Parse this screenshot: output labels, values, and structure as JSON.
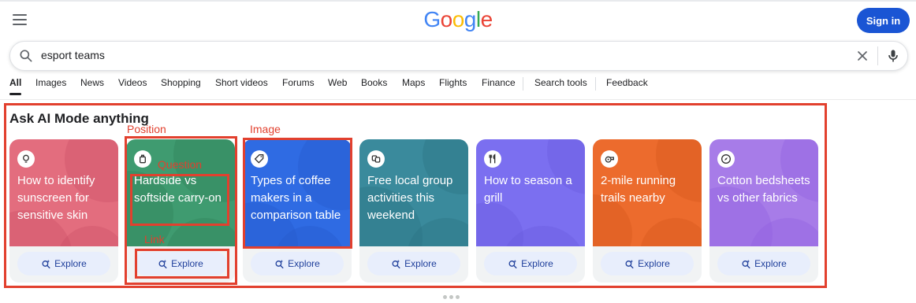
{
  "header": {
    "logo_letters": [
      {
        "ch": "G",
        "color": "#4285f4"
      },
      {
        "ch": "o",
        "color": "#ea4335"
      },
      {
        "ch": "o",
        "color": "#fbbc05"
      },
      {
        "ch": "g",
        "color": "#4285f4"
      },
      {
        "ch": "l",
        "color": "#34a853"
      },
      {
        "ch": "e",
        "color": "#ea4335"
      }
    ],
    "signin_label": "Sign in"
  },
  "search": {
    "query": "esport teams"
  },
  "tabs": [
    {
      "label": "All",
      "active": true
    },
    {
      "label": "Images"
    },
    {
      "label": "News"
    },
    {
      "label": "Videos"
    },
    {
      "label": "Shopping"
    },
    {
      "label": "Short videos"
    },
    {
      "label": "Forums"
    },
    {
      "label": "Web"
    },
    {
      "label": "Books"
    },
    {
      "label": "Maps"
    },
    {
      "label": "Flights"
    },
    {
      "label": "Finance"
    },
    {
      "label": "Search tools"
    },
    {
      "label": "Feedback"
    }
  ],
  "section": {
    "title": "Ask AI Mode anything"
  },
  "annotations": {
    "position": "Position",
    "image": "Image",
    "question": "Question",
    "link": "Link"
  },
  "cards": [
    {
      "text": "How to identify sunscreen for sensitive skin",
      "bg": "#e36d7e",
      "blob": "#c84c63",
      "icon": "bulb-icon",
      "explore": "Explore"
    },
    {
      "text": "Hardside vs softside carry-on",
      "bg": "#3f9b70",
      "blob": "#2d7f57",
      "icon": "luggage-icon",
      "explore": "Explore"
    },
    {
      "text": "Types of coffee makers in a comparison table",
      "bg": "#2f6be3",
      "blob": "#2559c8",
      "icon": "tag-icon",
      "explore": "Explore"
    },
    {
      "text": "Free local group activities this weekend",
      "bg": "#3a8a9c",
      "blob": "#2c7182",
      "icon": "theater-icon",
      "explore": "Explore"
    },
    {
      "text": "How to season a grill",
      "bg": "#7b6ff0",
      "blob": "#6658de",
      "icon": "utensils-icon",
      "explore": "Explore"
    },
    {
      "text": "2-mile running trails nearby",
      "bg": "#ec6b2d",
      "blob": "#d4561b",
      "icon": "whistle-icon",
      "explore": "Explore"
    },
    {
      "text": "Cotton bedsheets vs other fabrics",
      "bg": "#a77ce8",
      "blob": "#8f5fe0",
      "icon": "compass-icon",
      "explore": "Explore"
    }
  ]
}
